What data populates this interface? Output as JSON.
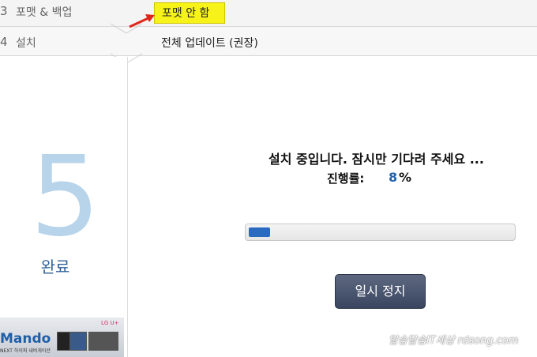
{
  "steps": [
    {
      "num": "3",
      "label": "포맷 & 백업",
      "option": "포맷 안 함"
    },
    {
      "num": "4",
      "label": "설치",
      "option": "전체 업데이트 (권장)"
    }
  ],
  "current_step": {
    "num": "5",
    "label": "완료"
  },
  "install": {
    "message": "설치 중입니다. 잠시만 기다려 주세요 ...",
    "progress_label": "진행률:",
    "progress_value": "8",
    "progress_unit": "%",
    "progress_fraction": 0.08
  },
  "pause_button": "일시 정지",
  "banner": {
    "brand": "Mando",
    "subtitle": "NEXT 하이퍼 내비게이션",
    "logo": "LG U+"
  },
  "watermark": "알송달송IT세상 rdsong.com",
  "colors": {
    "highlight": "#f7f21a",
    "accent": "#2a6bc0",
    "button": "#4a5470",
    "arrow": "#e0261b"
  },
  "icons": {
    "annotation": "red-arrow-icon"
  }
}
